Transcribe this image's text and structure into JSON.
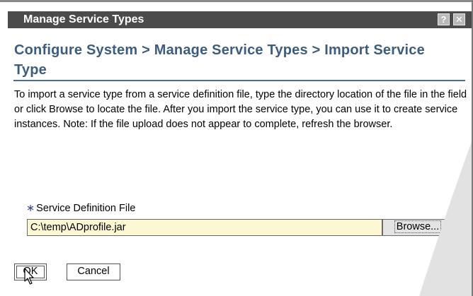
{
  "window": {
    "title": "Manage Service Types",
    "help_glyph": "?",
    "close_glyph": "✕"
  },
  "page": {
    "heading": "Configure System > Manage Service Types > Import Service Type",
    "instructions": "To import a service type from a service definition file, type the directory location of the file in the field or click Browse to locate the file. After you import the service type, you can use it to create service instances. Note: If the file upload does not appear to complete, refresh the browser."
  },
  "form": {
    "required_mark": "∗",
    "field_label": "Service Definition File",
    "file_value": "C:\\temp\\ADprofile.jar",
    "browse_label": "Browse..."
  },
  "actions": {
    "ok_label": "OK",
    "cancel_label": "Cancel"
  },
  "colors": {
    "titlebar": "#4b4b4b",
    "heading": "#3d5d7f",
    "input_bg": "#fdf7d4"
  },
  "icons": {
    "help": "help-icon",
    "close": "close-icon",
    "cursor": "mouse-pointer-icon"
  }
}
